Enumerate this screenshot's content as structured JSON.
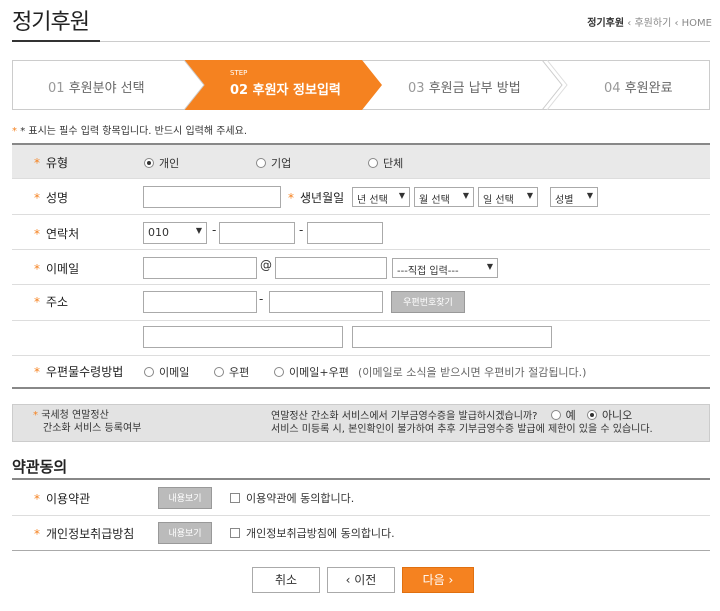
{
  "header": {
    "title": "정기후원",
    "breadcrumb": {
      "current": "정기후원",
      "sep1": "‹",
      "item2": "후원하기",
      "sep2": "‹",
      "item3": "HOME"
    }
  },
  "steps": [
    {
      "num": "01",
      "label": "후원분야 선택"
    },
    {
      "num": "02",
      "label": "후원자 정보입력",
      "step_tag": "STEP",
      "active": true
    },
    {
      "num": "03",
      "label": "후원금 납부 방법"
    },
    {
      "num": "04",
      "label": "후원완료"
    }
  ],
  "notice": "* 표시는 필수 입력 항목입니다. 반드시 입력해 주세요.",
  "form": {
    "type": {
      "label": "유형",
      "options": [
        "개인",
        "기업",
        "단체"
      ],
      "selected": "개인"
    },
    "name": {
      "label": "성명",
      "value": ""
    },
    "birth": {
      "label": "생년월일",
      "year": "년 선택",
      "month": "월 선택",
      "day": "일 선택",
      "gender": "성별"
    },
    "phone": {
      "label": "연락처",
      "prefix": "010",
      "dash": "-",
      "mid": "",
      "last": ""
    },
    "email": {
      "label": "이메일",
      "id": "",
      "at": "@",
      "domain": "",
      "domain_select": "---직접 입력---"
    },
    "address": {
      "label": "주소",
      "zip1": "",
      "dash": "-",
      "zip2": "",
      "zip_button": "우편번호찾기",
      "addr1": "",
      "addr2": ""
    },
    "mail_method": {
      "label": "우편물수령방법",
      "options": [
        "이메일",
        "우편",
        "이메일+우편"
      ],
      "note": "(이메일로 소식을 받으시면 우편비가 절감됩니다.)"
    },
    "tax": {
      "label_line1": "국세청 연말정산",
      "label_line2": "간소화 서비스 등록여부",
      "question": "연말정산 간소화 서비스에서 기부금영수증을 발급하시겠습니까?",
      "yes": "예",
      "no": "아니오",
      "selected": "아니오",
      "warning": "서비스 미등록 시, 본인확인이 불가하여 추후 기부금영수증 발급에 제한이 있을 수 있습니다."
    }
  },
  "terms": {
    "section_title": "약관동의",
    "items": [
      {
        "label": "이용약관",
        "view_button": "내용보기",
        "agree": "이용약관에 동의합니다."
      },
      {
        "label": "개인정보취급방침",
        "view_button": "내용보기",
        "agree": "개인정보취급방침에 동의합니다."
      }
    ]
  },
  "buttons": {
    "cancel": "취소",
    "prev": "‹ 이전",
    "next": "다음 ›"
  },
  "colors": {
    "accent": "#f58220",
    "shade": "#e9e9e9"
  }
}
